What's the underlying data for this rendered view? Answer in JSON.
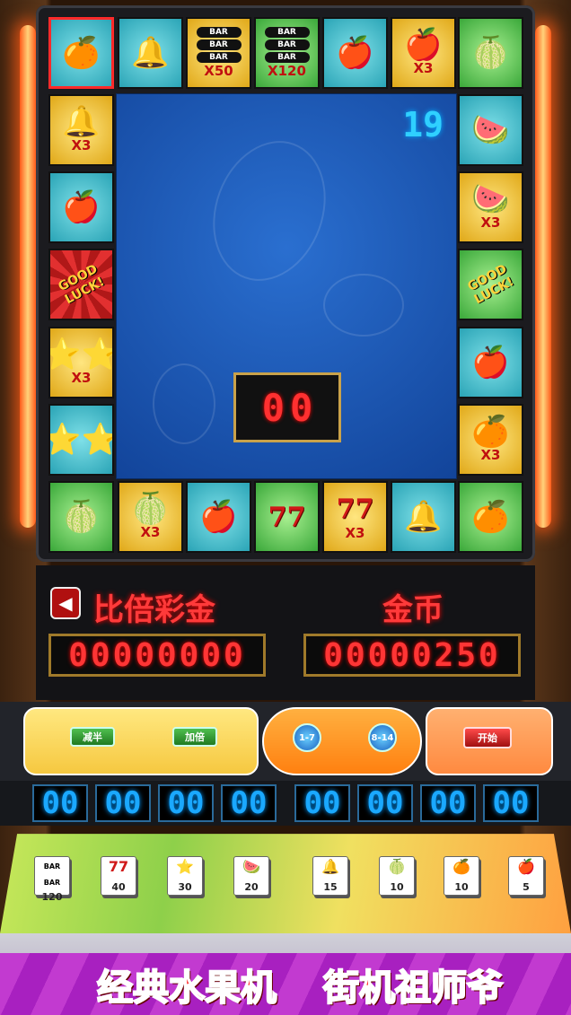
{
  "board": {
    "top": [
      {
        "name": "orange",
        "icon": "🍊",
        "mult": "",
        "color": "teal",
        "selected": true
      },
      {
        "name": "bell",
        "icon": "🔔",
        "mult": "",
        "color": "teal"
      },
      {
        "name": "bar",
        "icon": "BAR",
        "mult": "X50",
        "color": "yellow"
      },
      {
        "name": "bar",
        "icon": "BAR",
        "mult": "X120",
        "color": "green"
      },
      {
        "name": "apple",
        "icon": "🍎",
        "mult": "",
        "color": "teal"
      },
      {
        "name": "apple",
        "icon": "🍎",
        "mult": "X3",
        "color": "yellow"
      },
      {
        "name": "lime",
        "icon": "🍈",
        "mult": "",
        "color": "green"
      }
    ],
    "left": [
      {
        "name": "bell",
        "icon": "🔔",
        "mult": "X3",
        "color": "yellow"
      },
      {
        "name": "apple",
        "icon": "🍎",
        "mult": "",
        "color": "teal"
      },
      {
        "name": "good-luck",
        "icon": "GOOD LUCK!",
        "mult": "",
        "color": "red"
      },
      {
        "name": "star",
        "icon": "⭐⭐",
        "mult": "X3",
        "color": "yellow"
      },
      {
        "name": "star",
        "icon": "⭐⭐",
        "mult": "",
        "color": "teal"
      }
    ],
    "right": [
      {
        "name": "watermelon",
        "icon": "🍉",
        "mult": "",
        "color": "teal"
      },
      {
        "name": "watermelon",
        "icon": "🍉",
        "mult": "X3",
        "color": "yellow"
      },
      {
        "name": "good-luck",
        "icon": "GOOD LUCK!",
        "mult": "",
        "color": "green"
      },
      {
        "name": "apple",
        "icon": "🍎",
        "mult": "",
        "color": "teal"
      },
      {
        "name": "orange",
        "icon": "🍊",
        "mult": "X3",
        "color": "yellow"
      }
    ],
    "bottom": [
      {
        "name": "lime",
        "icon": "🍈",
        "mult": "",
        "color": "green"
      },
      {
        "name": "lime",
        "icon": "🍈",
        "mult": "X3",
        "color": "yellow"
      },
      {
        "name": "apple",
        "icon": "🍎",
        "mult": "",
        "color": "teal"
      },
      {
        "name": "seven",
        "icon": "77",
        "mult": "",
        "color": "green"
      },
      {
        "name": "seven",
        "icon": "77",
        "mult": "X3",
        "color": "yellow"
      },
      {
        "name": "bell",
        "icon": "🔔",
        "mult": "",
        "color": "teal"
      },
      {
        "name": "orange",
        "icon": "🍊",
        "mult": "",
        "color": "green"
      }
    ]
  },
  "timer": "19",
  "mini_display": [
    "0",
    "0"
  ],
  "labels": {
    "bonus": "比倍彩金",
    "coins": "金币"
  },
  "counters": {
    "bonus": "00000000",
    "coins": "00000250"
  },
  "buttons": {
    "half": "减半",
    "double": "加倍",
    "small": "1-7",
    "big": "8-14",
    "start": "开始"
  },
  "bets": [
    "00",
    "00",
    "00",
    "00",
    "00",
    "00",
    "00",
    "00"
  ],
  "paytable": [
    {
      "name": "bar",
      "icon": "BAR",
      "value": "120"
    },
    {
      "name": "seven",
      "icon": "77",
      "value": "40"
    },
    {
      "name": "star",
      "icon": "⭐",
      "value": "30"
    },
    {
      "name": "watermelon",
      "icon": "🍉",
      "value": "20"
    },
    {
      "name": "bell",
      "icon": "🔔",
      "value": "15"
    },
    {
      "name": "lime",
      "icon": "🍈",
      "value": "10"
    },
    {
      "name": "orange",
      "icon": "🍊",
      "value": "10"
    },
    {
      "name": "apple",
      "icon": "🍎",
      "value": "5"
    }
  ],
  "banner": {
    "left": "经典水果机",
    "right": "街机祖师爷"
  },
  "colors": {
    "accent": "#ff3a3a",
    "bet_digits": "#1aa8ff",
    "neon": "#ff5a1a"
  }
}
